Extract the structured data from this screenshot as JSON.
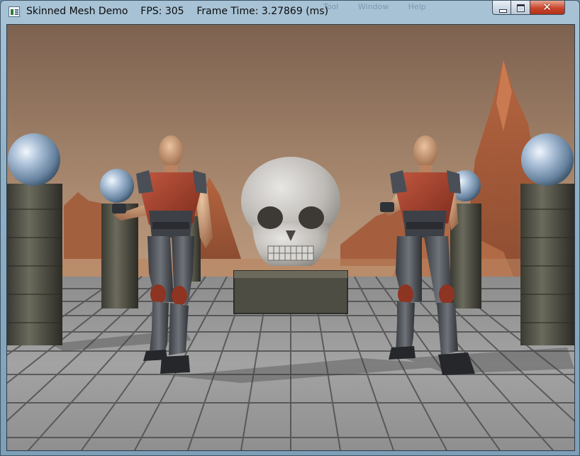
{
  "window": {
    "title": "Skinned Mesh Demo    FPS: 305    Frame Time: 3.27869 (ms)",
    "ghost_menu": [
      "Tool",
      "Window",
      "Help"
    ],
    "close_glyph": "✕"
  },
  "icons": {
    "app": "app-window-icon",
    "minimize": "minimize-icon",
    "maximize": "maximize-icon",
    "close": "close-icon"
  },
  "colors": {
    "sky_top": "#8a6b55",
    "sky_bottom": "#d3ae8f",
    "floor": "#9a9a9a",
    "armor_red": "#a8422e",
    "sphere": "#a9bfd6",
    "skull": "#c9c7c4"
  }
}
